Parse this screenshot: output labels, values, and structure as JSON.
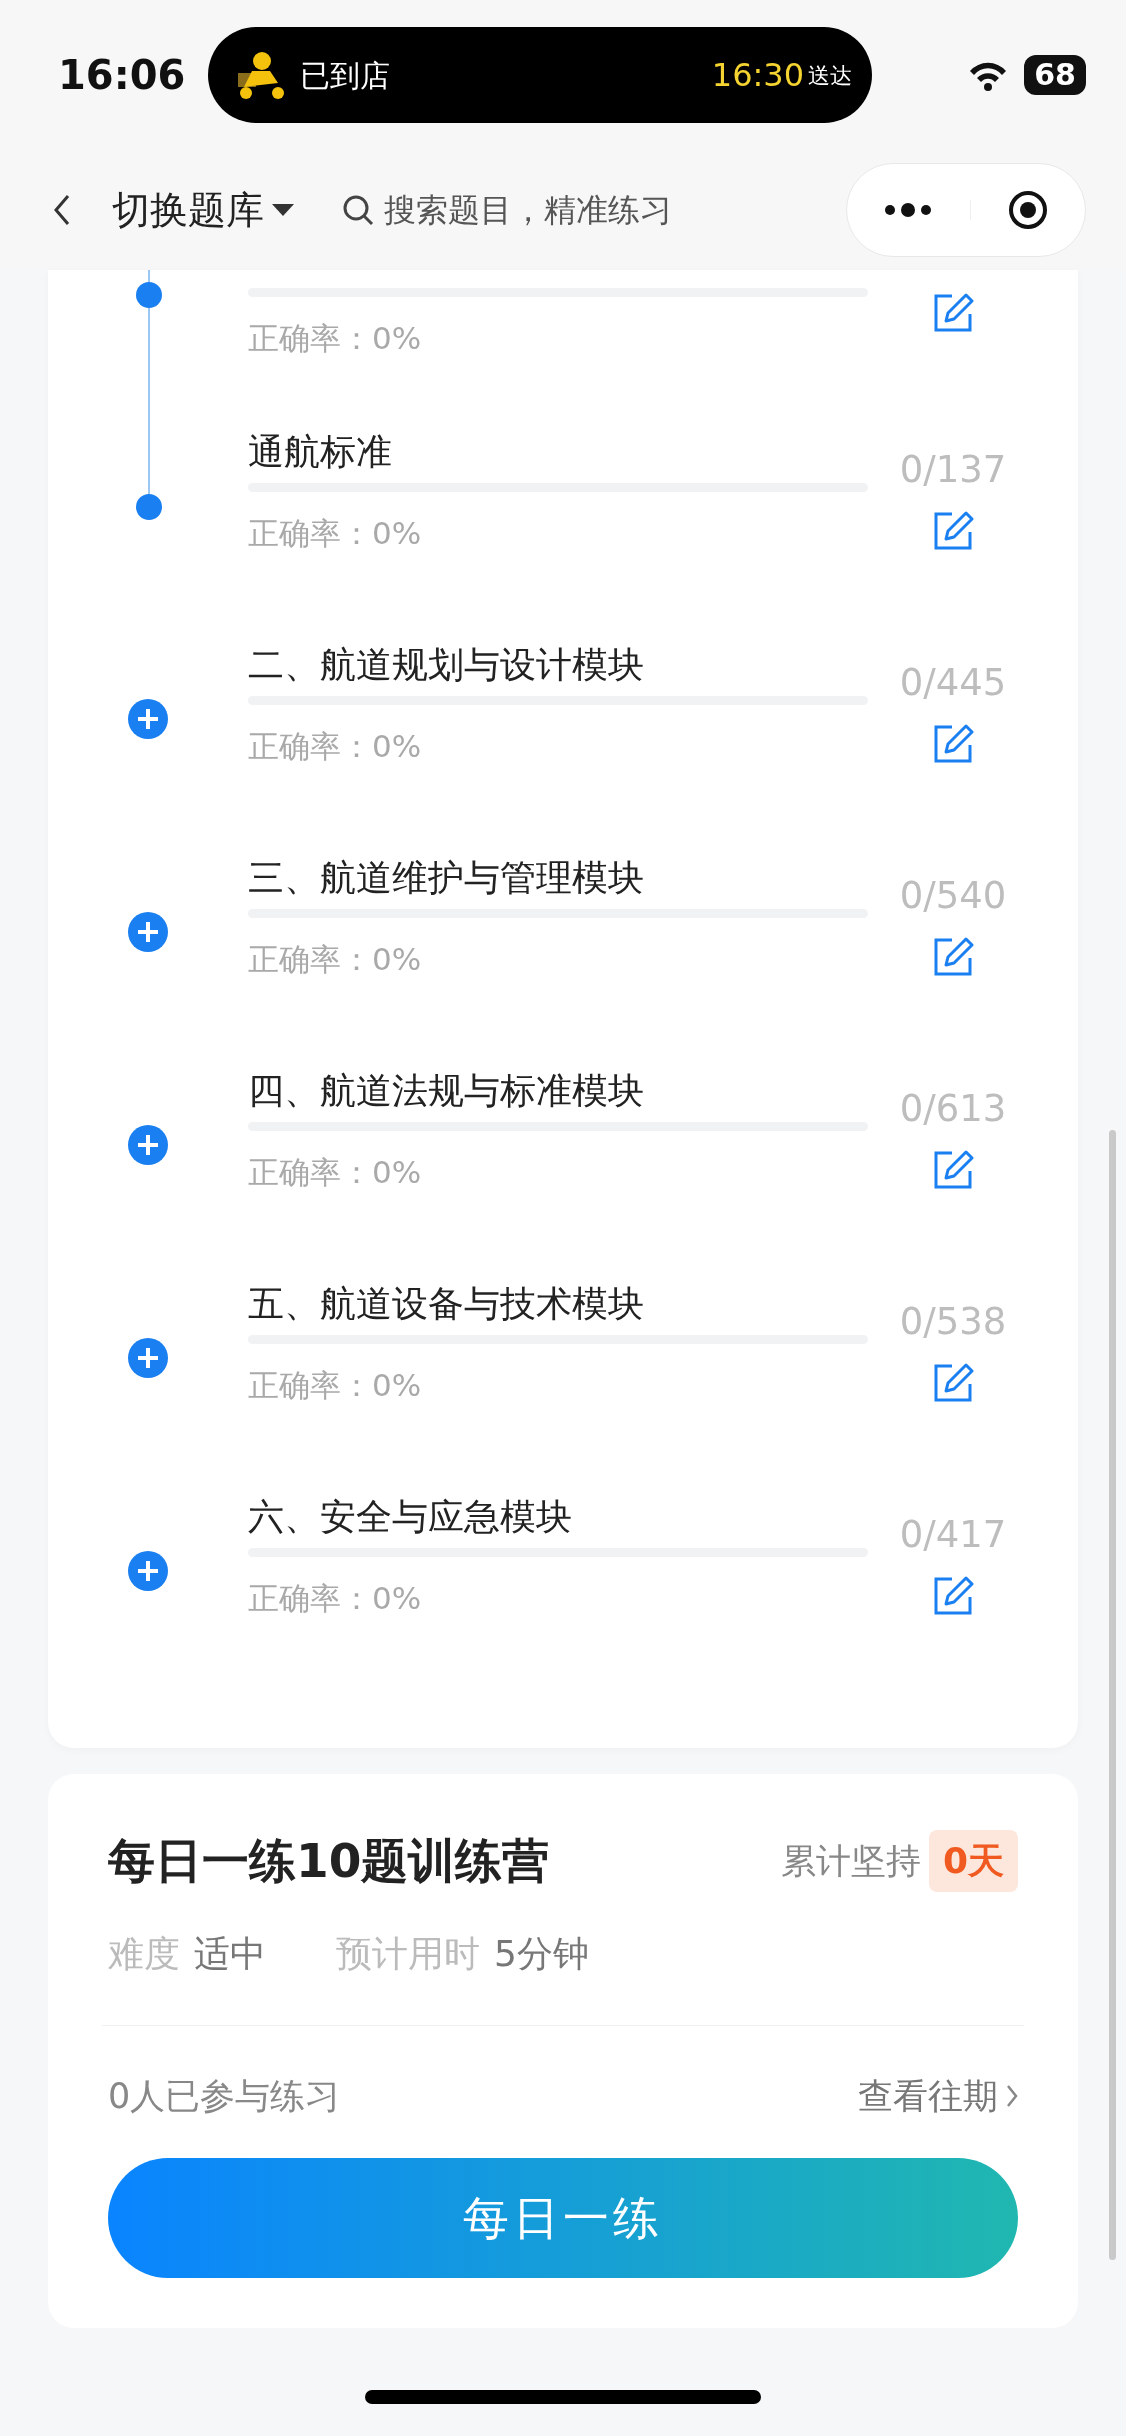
{
  "status_bar": {
    "time": "16:06",
    "live_activity": {
      "status": "已到店",
      "eta_time": "16:30",
      "eta_label": "送达"
    },
    "battery": "68"
  },
  "header": {
    "title": "切换题库",
    "search_placeholder": "搜索题目，精准练习"
  },
  "sections": [
    {
      "expanded": true,
      "children": [
        {
          "accuracy": "正确率：0%",
          "level": 0
        },
        {
          "title": "通航标准",
          "count": "0/137",
          "accuracy": "正确率：0%",
          "level": 0
        }
      ]
    },
    {
      "title": "二、航道规划与设计模块",
      "count": "0/445",
      "accuracy": "正确率：0%",
      "level": 0,
      "expanded": false
    },
    {
      "title": "三、航道维护与管理模块",
      "count": "0/540",
      "accuracy": "正确率：0%",
      "level": 0,
      "expanded": false
    },
    {
      "title": "四、航道法规与标准模块",
      "count": "0/613",
      "accuracy": "正确率：0%",
      "level": 0,
      "expanded": false
    },
    {
      "title": "五、航道设备与技术模块",
      "count": "0/538",
      "accuracy": "正确率：0%",
      "level": 0,
      "expanded": false
    },
    {
      "title": "六、安全与应急模块",
      "count": "0/417",
      "accuracy": "正确率：0%",
      "level": 0,
      "expanded": false
    }
  ],
  "daily_practice": {
    "title": "每日一练10题训练营",
    "streak_label": "累计坚持",
    "streak": "0天",
    "difficulty_label": "难度",
    "difficulty": "适中",
    "time_label": "预计用时",
    "time": "5分钟",
    "participants": "0人已参与练习",
    "history_link": "查看往期",
    "button": "每日一练"
  }
}
